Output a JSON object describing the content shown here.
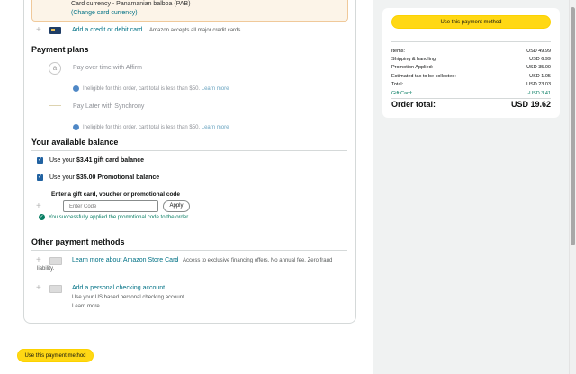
{
  "card_currency": {
    "line1": "Card currency - Panamanian balboa (PAB)",
    "change_link": "(Change card currency)"
  },
  "add_card": {
    "label": "Add a credit or debit card",
    "note": "Amazon accepts all major credit cards."
  },
  "payment_plans": {
    "title": "Payment plans",
    "plans": [
      {
        "name": "Pay over time with Affirm",
        "ineligible": "Ineligible for this order, cart total is less than $50.",
        "learn_more": "Learn more"
      },
      {
        "name": "Pay Later with Synchrony",
        "ineligible": "Ineligible for this order, cart total is less than $50.",
        "learn_more": "Learn more"
      }
    ]
  },
  "balance": {
    "title": "Your available balance",
    "gift_card": {
      "prefix": "Use your ",
      "amount": "$3.41 gift card balance"
    },
    "promo": {
      "prefix": "Use your ",
      "amount": "$35.00 Promotional balance"
    },
    "code_label": "Enter a gift card, voucher or promotional code",
    "code_placeholder": "Enter Code",
    "apply_label": "Apply",
    "success": "You successfully applied the promotional code to the order."
  },
  "other_methods": {
    "title": "Other payment methods",
    "store_card": {
      "link": "Learn more about Amazon Store Card",
      "desc": "Access to exclusive financing offers. No annual fee. Zero fraud",
      "desc2": "liability."
    },
    "checking": {
      "link": "Add a personal checking account",
      "desc": "Use your US based personal checking account.",
      "learn_more": "Learn more"
    }
  },
  "use_method_label": "Use this payment method",
  "summary": {
    "button": "Use this payment method",
    "rows": [
      {
        "label": "Items:",
        "value": "USD 49.99"
      },
      {
        "label": "Shipping & handling:",
        "value": "USD 6.99"
      },
      {
        "label": "Promotion Applied:",
        "value": "-USD 35.00"
      },
      {
        "label": "Estimated tax to be collected:",
        "value": "USD 1.05"
      },
      {
        "label": "Total:",
        "value": "USD 23.03"
      },
      {
        "label": "Gift Card:",
        "value": "-USD 3.41"
      }
    ],
    "order_total_label": "Order total:",
    "order_total_value": "USD 19.62"
  },
  "colors": {
    "accent_yellow": "#ffd814",
    "link": "#007185",
    "success_green": "#067d62",
    "info_blue": "#4f88c6",
    "notice_bg": "#fcf4e8"
  },
  "icons": [
    "card-icon",
    "affirm-icon",
    "synchrony-icon",
    "info-icon",
    "checkbox-checked-icon",
    "check-circle-icon",
    "plus-icon",
    "store-card-icon",
    "checking-account-icon"
  ]
}
